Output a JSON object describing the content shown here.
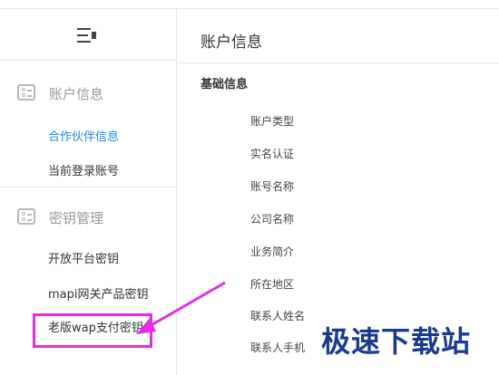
{
  "sidebar": {
    "groups": [
      {
        "label": "账户信息",
        "items": [
          {
            "label": "合作伙伴信息",
            "active": true
          },
          {
            "label": "当前登录账号",
            "active": false
          }
        ]
      },
      {
        "label": "密钥管理",
        "items": [
          {
            "label": "开放平台密钥",
            "active": false
          },
          {
            "label": "mapi网关产品密钥",
            "active": false
          },
          {
            "label": "老版wap支付密钥",
            "active": false
          }
        ]
      }
    ]
  },
  "main": {
    "title": "账户信息",
    "section": "基础信息",
    "fields": [
      "账户类型",
      "实名认证",
      "账号名称",
      "公司名称",
      "业务简介",
      "所在地区",
      "联系人姓名",
      "联系人手机"
    ]
  },
  "annotation": {
    "color": "#e62ce0"
  },
  "watermark": "极速下载站",
  "colors": {
    "accent": "#1e88e5",
    "highlight": "#e62ce0"
  }
}
